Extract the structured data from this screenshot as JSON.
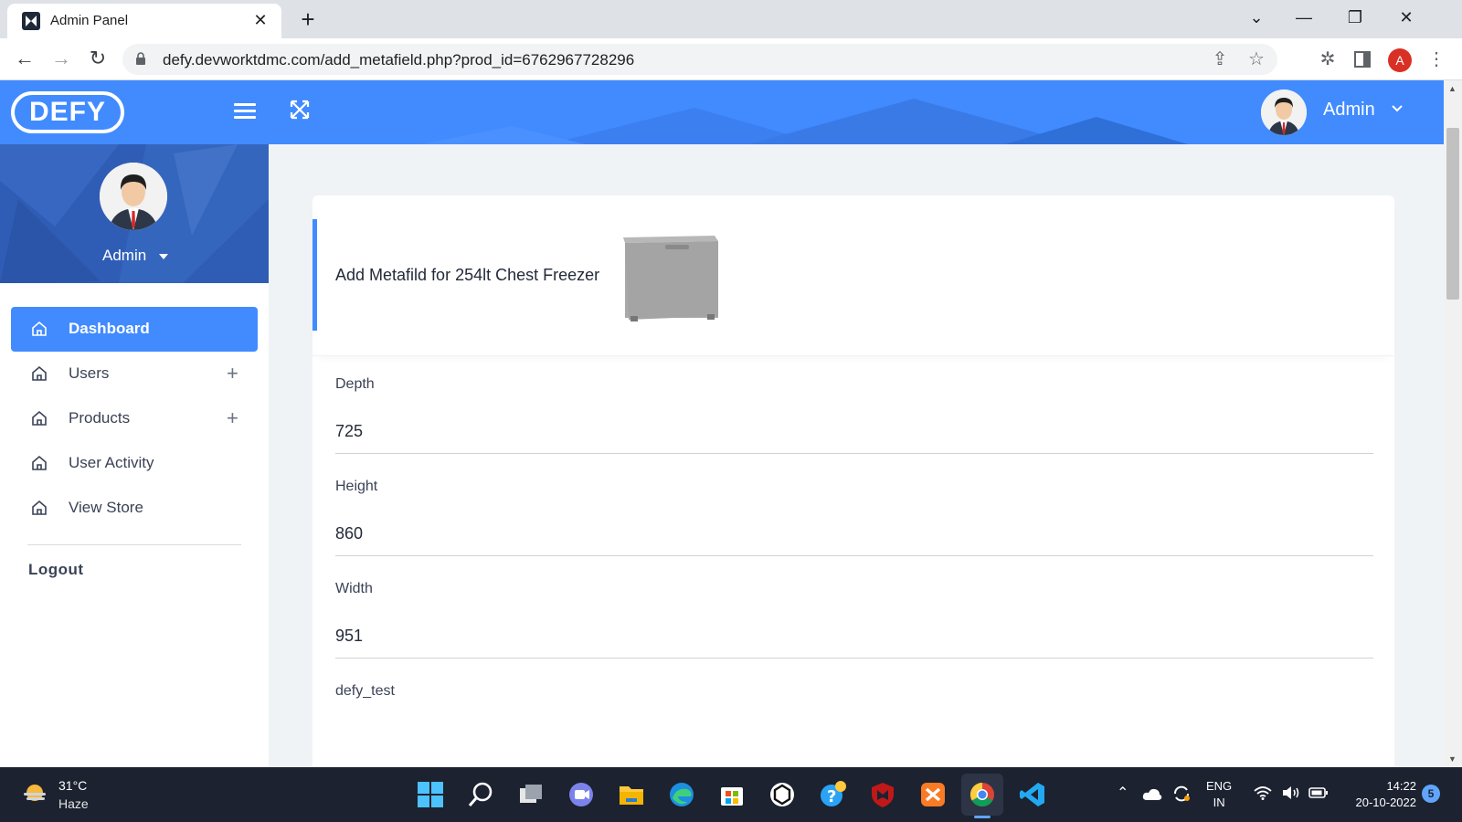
{
  "browser": {
    "tab_title": "Admin Panel",
    "tab_close": "✕",
    "new_tab": "+",
    "url": "defy.devworktdmc.com/add_metafield.php?prod_id=6762967728296",
    "profile_initial": "A",
    "window_controls": {
      "dropdown": "⌄",
      "minimize": "—",
      "restore": "❐",
      "close": "✕"
    },
    "nav": {
      "back": "←",
      "forward": "→",
      "reload": "↻"
    }
  },
  "header": {
    "logo": "DEFY",
    "user_name": "Admin"
  },
  "sidebar": {
    "user_name": "Admin",
    "items": [
      {
        "label": "Dashboard",
        "icon": "home-icon",
        "active": true,
        "expandable": false
      },
      {
        "label": "Users",
        "icon": "home-icon",
        "active": false,
        "expandable": true
      },
      {
        "label": "Products",
        "icon": "home-icon",
        "active": false,
        "expandable": true
      },
      {
        "label": "User Activity",
        "icon": "home-icon",
        "active": false,
        "expandable": false
      },
      {
        "label": "View Store",
        "icon": "home-icon",
        "active": false,
        "expandable": false
      }
    ],
    "expand_symbol": "+",
    "logout": "Logout"
  },
  "main": {
    "title": "Add Metafild for 254lt Chest Freezer",
    "fields": [
      {
        "label": "Depth",
        "value": "725"
      },
      {
        "label": "Height",
        "value": "860"
      },
      {
        "label": "Width",
        "value": "951"
      },
      {
        "label": "defy_test",
        "value": ""
      }
    ]
  },
  "taskbar": {
    "temperature": "31°C",
    "weather": "Haze",
    "language_line1": "ENG",
    "language_line2": "IN",
    "time": "14:22",
    "date": "20-10-2022",
    "notification_count": "5"
  },
  "colors": {
    "accent": "#418bff",
    "sidebar_profile_bg": "#2f5db5",
    "main_bg": "#f0f3f6",
    "taskbar_bg": "#1c2230"
  }
}
